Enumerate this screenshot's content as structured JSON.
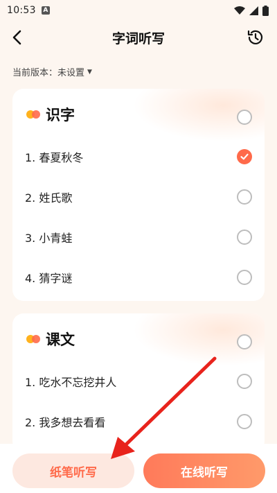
{
  "status": {
    "time": "10:53",
    "notif": "A"
  },
  "nav": {
    "title": "字词听写"
  },
  "version": {
    "label": "当前版本：",
    "value": "未设置"
  },
  "sections": [
    {
      "title": "识字",
      "items": [
        {
          "label": "1. 春夏秋冬",
          "checked": true
        },
        {
          "label": "2. 姓氏歌",
          "checked": false
        },
        {
          "label": "3. 小青蛙",
          "checked": false
        },
        {
          "label": "4. 猜字谜",
          "checked": false
        }
      ]
    },
    {
      "title": "课文",
      "items": [
        {
          "label": "1. 吃水不忘挖井人",
          "checked": false
        },
        {
          "label": "2. 我多想去看看",
          "checked": false
        }
      ]
    }
  ],
  "buttons": {
    "paper": "纸笔听写",
    "online": "在线听写"
  },
  "colors": {
    "accent": "#ff6a4a",
    "annotation_arrow": "#e8231c"
  }
}
